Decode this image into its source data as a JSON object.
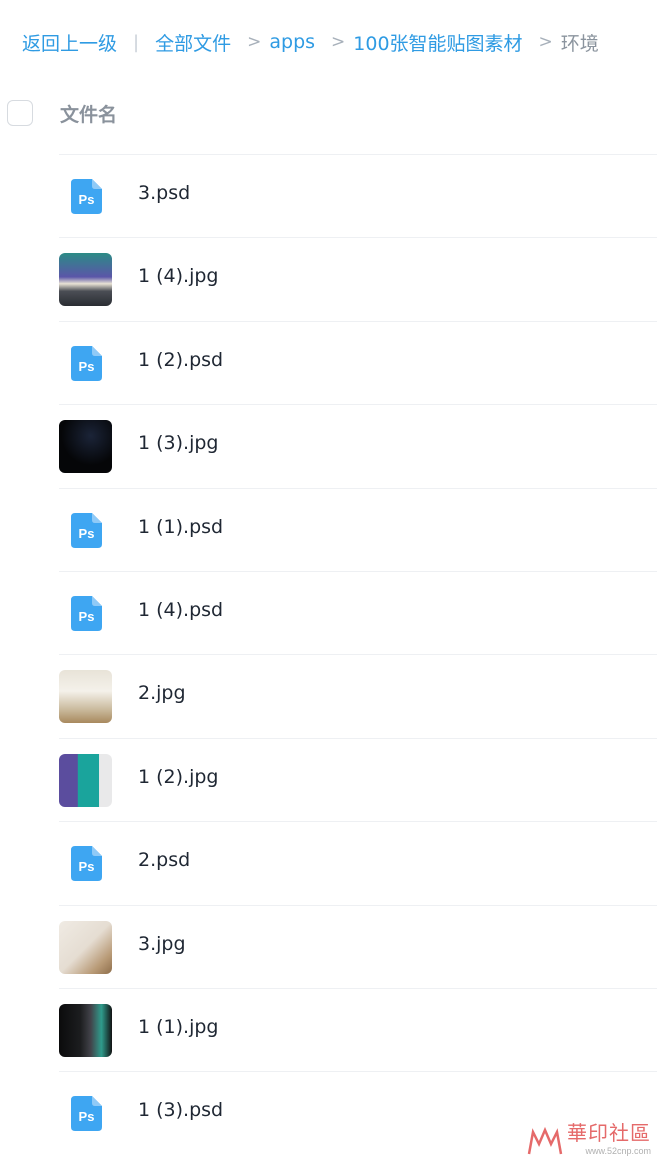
{
  "breadcrumb": {
    "back": "返回上一级",
    "bar": "|",
    "items": [
      "全部文件",
      "apps",
      "100张智能贴图素材"
    ],
    "sep": ">",
    "current": "环境"
  },
  "header": {
    "name_column": "文件名"
  },
  "files": [
    {
      "name": "3.psd",
      "type": "psd"
    },
    {
      "name": "1 (4).jpg",
      "type": "jpg"
    },
    {
      "name": "1 (2).psd",
      "type": "psd"
    },
    {
      "name": "1 (3).jpg",
      "type": "jpg"
    },
    {
      "name": "1 (1).psd",
      "type": "psd"
    },
    {
      "name": "1 (4).psd",
      "type": "psd"
    },
    {
      "name": "2.jpg",
      "type": "jpg"
    },
    {
      "name": "1 (2).jpg",
      "type": "jpg"
    },
    {
      "name": "2.psd",
      "type": "psd"
    },
    {
      "name": "3.jpg",
      "type": "jpg"
    },
    {
      "name": "1 (1).jpg",
      "type": "jpg"
    },
    {
      "name": "1 (3).psd",
      "type": "psd"
    }
  ],
  "icons": {
    "psd": "photoshop-file-icon",
    "jpg": "image-thumbnail"
  },
  "colors": {
    "link": "#2f9be3",
    "ps_icon": "#3ea6f2",
    "text": "#1f2733",
    "muted": "#8b949e"
  },
  "watermark": {
    "text": "華印社區",
    "sub": "www.52cnp.com"
  }
}
